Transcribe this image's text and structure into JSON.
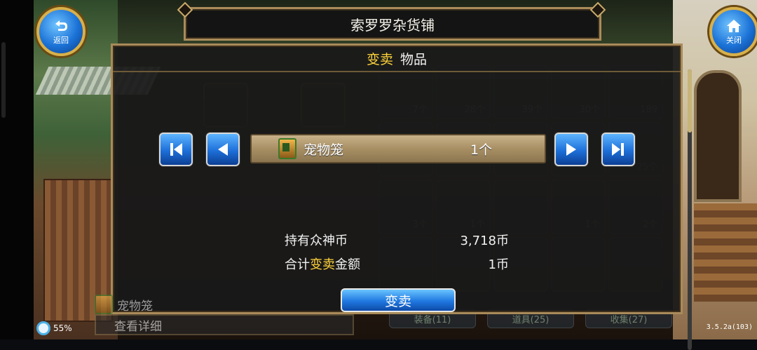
{
  "window": {
    "title": "索罗罗杂货铺"
  },
  "top_buttons": {
    "back_label": "返回",
    "close_label": "关闭"
  },
  "dialog": {
    "header_action": "变卖",
    "header_object": "物品",
    "item": {
      "name": "宠物笼",
      "quantity": "1个",
      "icon": "pet-cage-icon"
    },
    "holdings_label": "持有众神币",
    "holdings_value": "3,718币",
    "total_label_prefix": "合计",
    "total_label_highlight": "变卖",
    "total_label_suffix": "金额",
    "total_value": "1币",
    "sell_button": "变卖"
  },
  "background": {
    "grid_counts": [
      "7个",
      "28个",
      "39个",
      "30个",
      "189",
      "",
      "",
      "",
      "",
      "25个",
      "3个",
      "1个",
      "",
      "1个",
      "2个",
      "",
      "",
      "",
      "",
      ""
    ],
    "tabs": [
      "装备(11)",
      "道具(25)",
      "收集(27)"
    ],
    "selected_item": "宠物笼",
    "detail_button": "查看详细"
  },
  "status": {
    "battery": "55%",
    "version": "3.5.2a(103)"
  },
  "colors": {
    "accent_yellow": "#ffd23a",
    "frame_gold": "#a98b5a",
    "button_blue": "#1f78e0"
  }
}
